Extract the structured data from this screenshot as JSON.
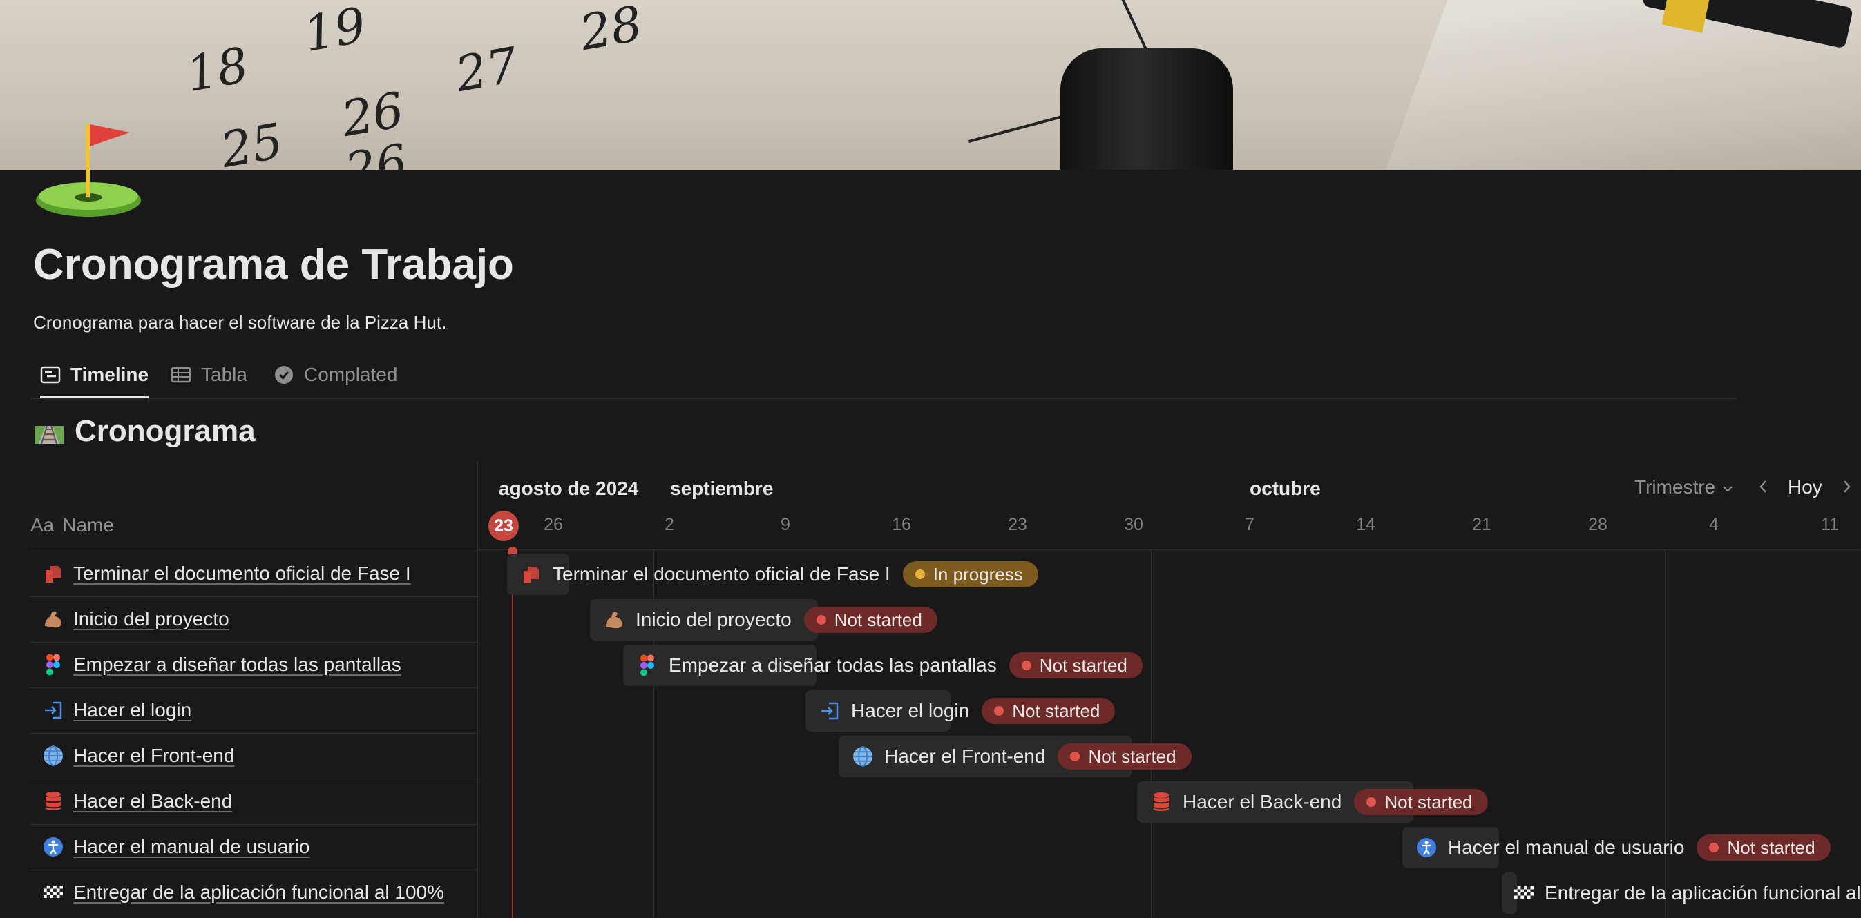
{
  "cover": {
    "numbers": [
      "18",
      "19",
      "26",
      "25",
      "26",
      "27",
      "28"
    ]
  },
  "page": {
    "title": "Cronograma de Trabajo",
    "description": "Cronograma para hacer el software de la Pizza Hut."
  },
  "tabs": [
    {
      "label": "Timeline",
      "icon": "timeline-icon",
      "active": true
    },
    {
      "label": "Tabla",
      "icon": "table-icon",
      "active": false
    },
    {
      "label": "Complated",
      "icon": "check-circle-icon",
      "active": false
    }
  ],
  "database": {
    "title": "Cronograma",
    "icon": "railway-track-icon"
  },
  "table_header": {
    "aa": "Aa",
    "name": "Name"
  },
  "timeline": {
    "months": [
      "agosto de 2024",
      "septiembre",
      "octubre"
    ],
    "today": "23",
    "days": [
      "26",
      "2",
      "9",
      "16",
      "23",
      "30",
      "7",
      "14",
      "21",
      "28",
      "4",
      "11"
    ],
    "range_label": "Trimestre",
    "today_label": "Hoy"
  },
  "tasks": [
    {
      "name": "Terminar el documento oficial de Fase I",
      "icon": "document-icon",
      "status": "In progress",
      "status_color": "yellow"
    },
    {
      "name": "Inicio del proyecto",
      "icon": "flexed-biceps-icon",
      "status": "Not started",
      "status_color": "red"
    },
    {
      "name": "Empezar a diseñar todas las pantallas",
      "icon": "figma-icon",
      "status": "Not started",
      "status_color": "red"
    },
    {
      "name": "Hacer el login",
      "icon": "login-icon",
      "status": "Not started",
      "status_color": "red"
    },
    {
      "name": "Hacer el Front-end",
      "icon": "globe-icon",
      "status": "Not started",
      "status_color": "red"
    },
    {
      "name": "Hacer el Back-end",
      "icon": "database-icon",
      "status": "Not started",
      "status_color": "red"
    },
    {
      "name": "Hacer el manual de usuario",
      "icon": "accessibility-icon",
      "status": "Not started",
      "status_color": "red"
    },
    {
      "name": "Entregar de la aplicación funcional al 100%",
      "icon": "checkered-flag-icon",
      "status": "",
      "status_color": ""
    }
  ],
  "colors": {
    "background": "#191919",
    "in_progress": "#7d5a1e",
    "not_started": "#6e2a28",
    "today": "#c6473d"
  }
}
